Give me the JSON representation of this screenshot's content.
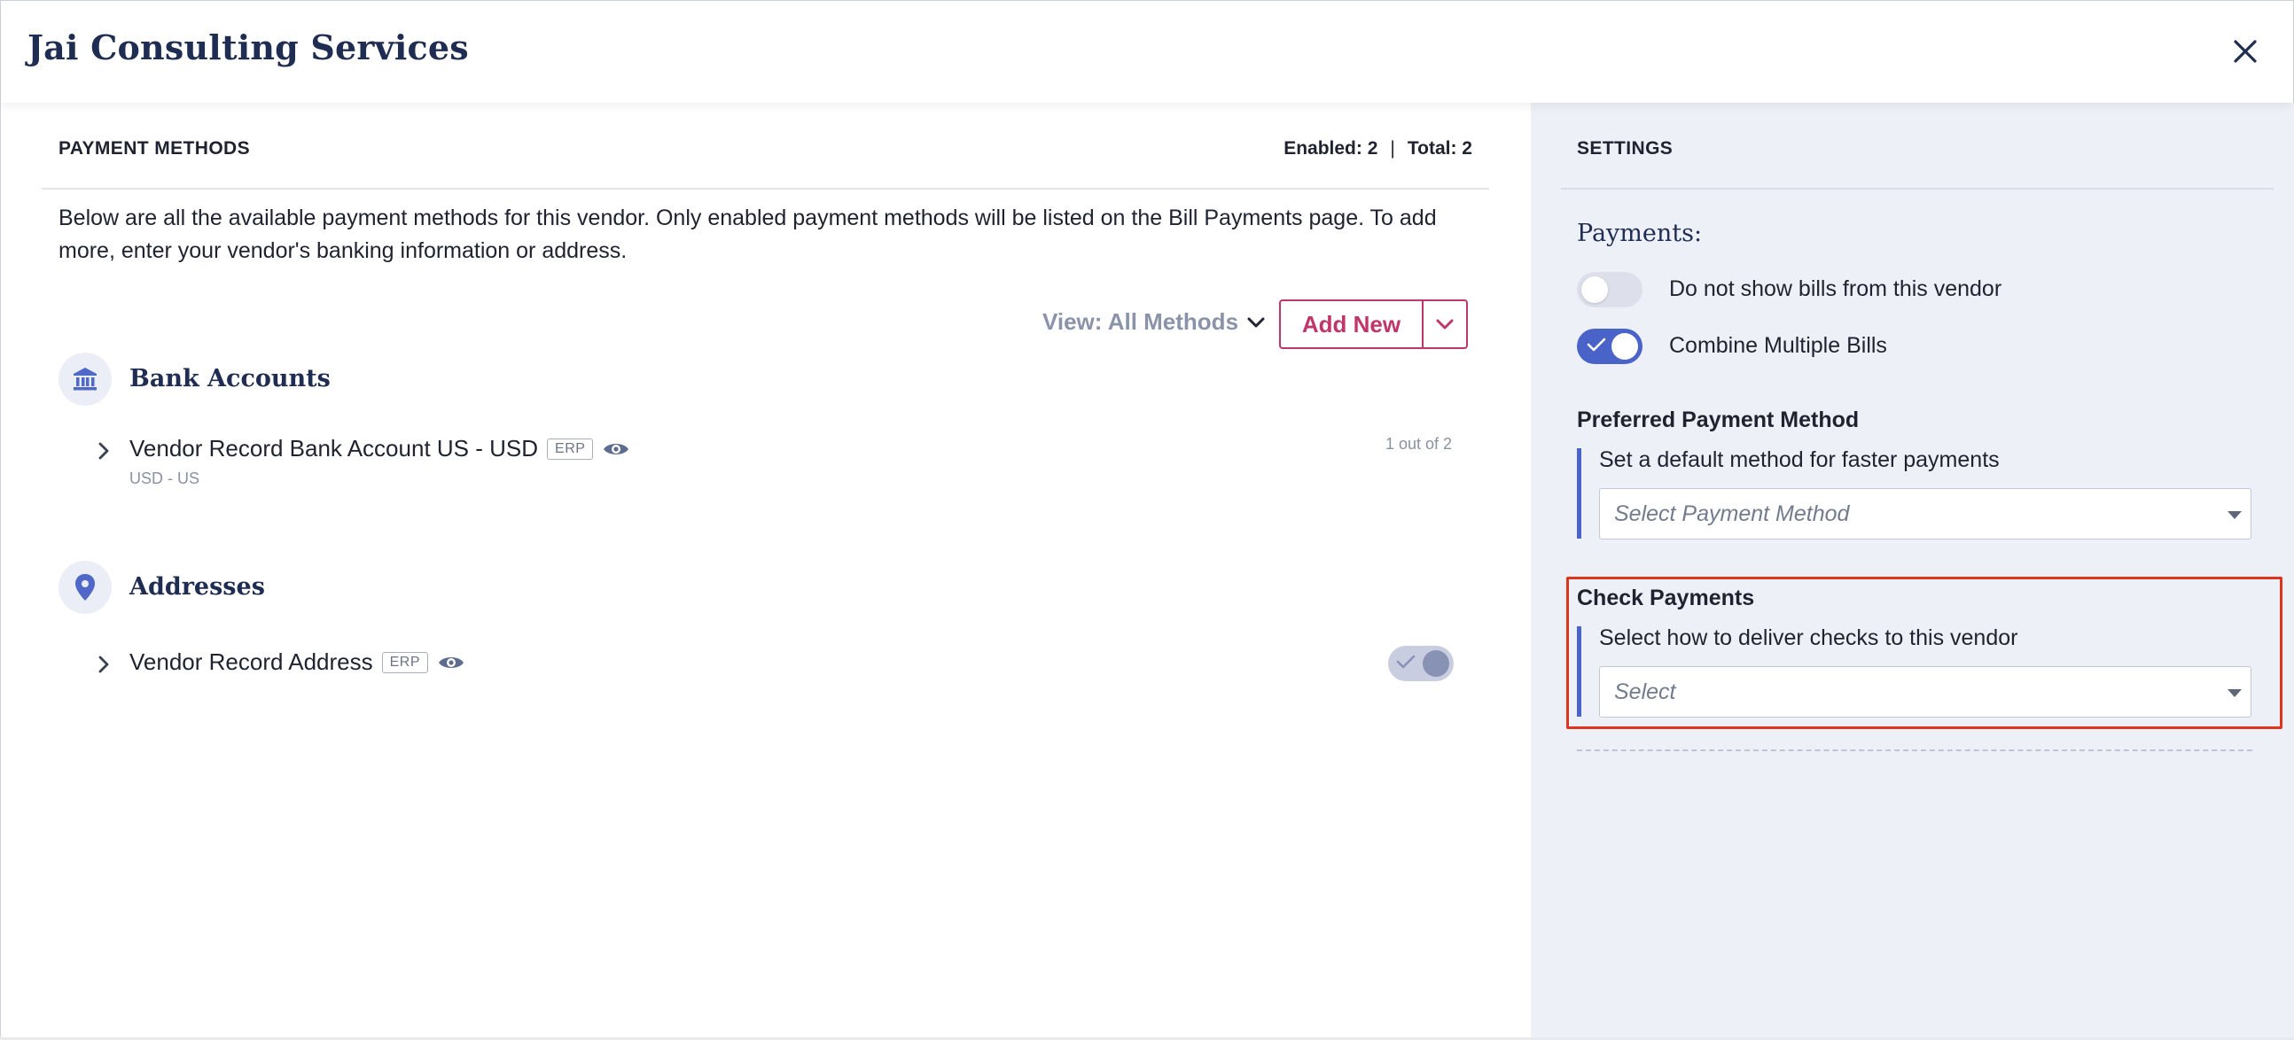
{
  "header": {
    "title": "Jai Consulting Services"
  },
  "payment_methods": {
    "section_title": "PAYMENT METHODS",
    "enabled_label": "Enabled: 2",
    "separator": "|",
    "total_label": "Total: 2",
    "description": "Below are all the available payment methods for this vendor. Only enabled payment methods will be listed on the Bill Payments page. To add more, enter your vendor's banking information or address.",
    "view_filter": "View: All Methods",
    "add_new_label": "Add New",
    "groups": [
      {
        "title": "Bank Accounts",
        "icon": "bank-icon",
        "items": [
          {
            "name": "Vendor Record Bank Account US - USD",
            "badge": "ERP",
            "sub": "USD - US",
            "count": "1 out of 2"
          }
        ]
      },
      {
        "title": "Addresses",
        "icon": "location-pin-icon",
        "items": [
          {
            "name": "Vendor Record Address",
            "badge": "ERP",
            "enabled": true
          }
        ]
      }
    ]
  },
  "settings": {
    "section_title": "SETTINGS",
    "payments_label": "Payments:",
    "toggles": [
      {
        "label": "Do not show bills from this vendor",
        "on": false
      },
      {
        "label": "Combine Multiple Bills",
        "on": true
      }
    ],
    "preferred": {
      "label": "Preferred Payment Method",
      "help": "Set a default method for faster payments",
      "placeholder": "Select Payment Method"
    },
    "check_payments": {
      "label": "Check Payments",
      "help": "Select how to deliver checks to this vendor",
      "placeholder": "Select"
    }
  },
  "colors": {
    "brand_navy": "#1f2d52",
    "accent_pink": "#c0356a",
    "toggle_blue": "#4a63c9",
    "highlight_red": "#e0341c",
    "settings_bg": "#eef0f8"
  }
}
